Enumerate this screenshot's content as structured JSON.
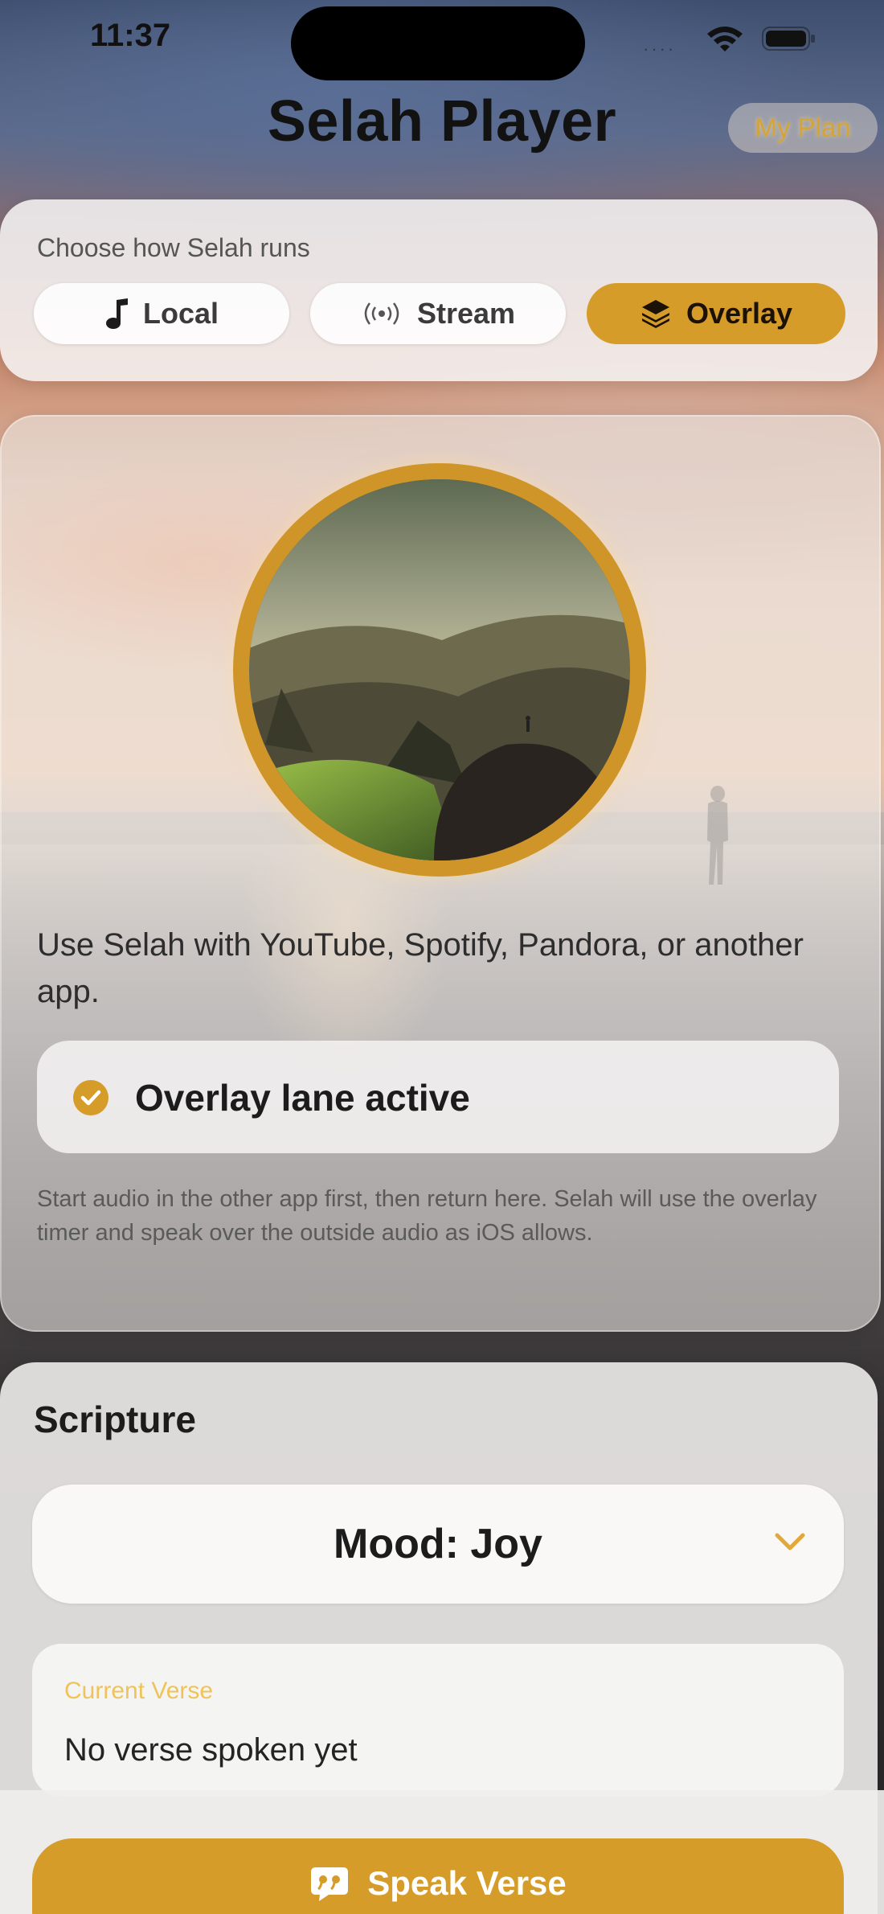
{
  "status_bar": {
    "time": "11:37",
    "signal_dots": "····",
    "icons": [
      "wifi-icon",
      "battery-icon"
    ]
  },
  "header": {
    "title": "Selah Player",
    "my_plan_label": "My Plan"
  },
  "mode_selector": {
    "label": "Choose how Selah runs",
    "options": [
      {
        "label": "Local",
        "icon": "music-note-icon",
        "selected": false
      },
      {
        "label": "Stream",
        "icon": "broadcast-icon",
        "selected": false
      },
      {
        "label": "Overlay",
        "icon": "layers-icon",
        "selected": true
      }
    ]
  },
  "overlay_panel": {
    "artwork": "mountain-artwork",
    "description": "Use Selah with YouTube, Spotify, Pandora, or another app.",
    "lane_status": "Overlay lane active",
    "helper": "Start audio in the other app first, then return here. Selah will use the overlay timer and speak over the outside audio as iOS allows."
  },
  "scripture": {
    "title": "Scripture",
    "mood_select_value": "Mood: Joy",
    "current_verse_label": "Current Verse",
    "current_verse_value": "No verse spoken yet",
    "speak_button_label": "Speak Verse"
  },
  "colors": {
    "accent": "#d59c2a",
    "title_text": "#121212",
    "verse_label": "#f0c35a"
  }
}
